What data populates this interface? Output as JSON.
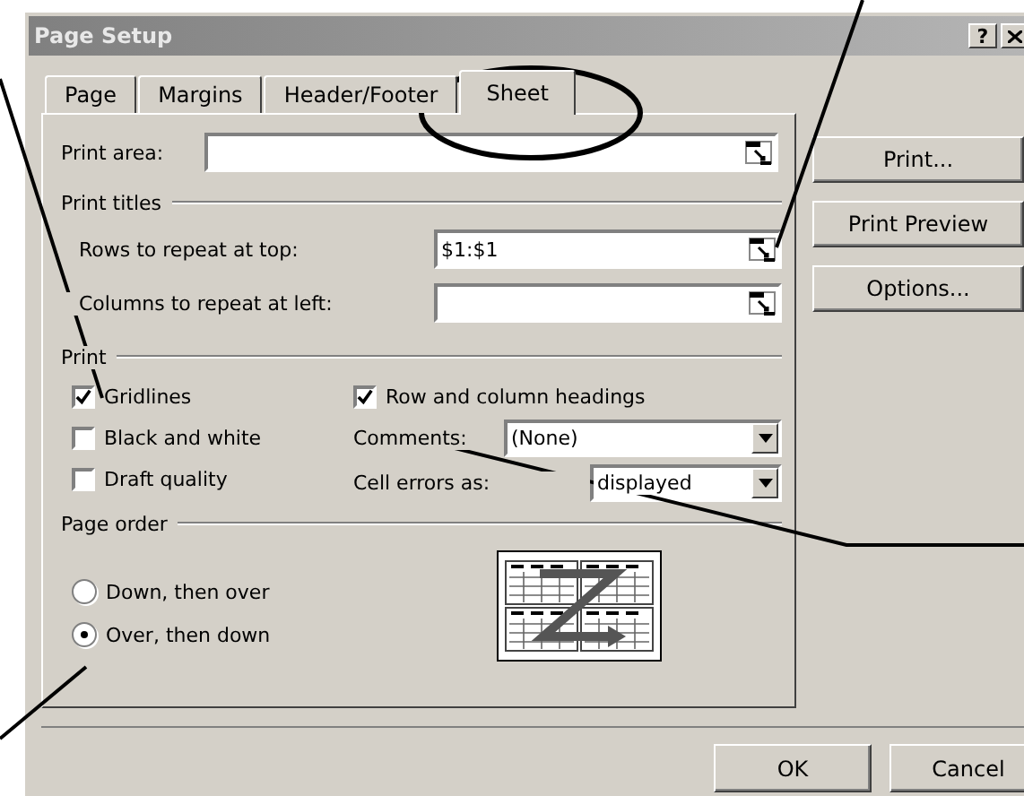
{
  "window": {
    "title": "Page Setup",
    "help_button": "?"
  },
  "tabs": [
    {
      "label": "Page",
      "selected": false
    },
    {
      "label": "Margins",
      "selected": false
    },
    {
      "label": "Header/Footer",
      "selected": false
    },
    {
      "label": "Sheet",
      "selected": true
    }
  ],
  "print_area": {
    "label": "Print area:"
  },
  "print_titles": {
    "heading": "Print titles",
    "fields": [
      {
        "label": "Rows to repeat at top:",
        "value": "$1:$1"
      },
      {
        "label": "Columns to repeat at left:"
      }
    ]
  },
  "print": {
    "heading": "Print",
    "checkboxes": [
      {
        "label": "Gridlines",
        "checked": true
      },
      {
        "label": "Black and white",
        "checked": false
      },
      {
        "label": "Draft quality",
        "checked": false
      },
      {
        "label": "Row and column headings",
        "checked": true
      }
    ],
    "comments": {
      "label": "Comments:",
      "value": "(None)"
    },
    "cell_errors": {
      "label": "Cell errors as:",
      "value": "displayed"
    }
  },
  "page_order": {
    "heading": "Page order",
    "options": [
      {
        "label": "Down, then over",
        "selected": false
      },
      {
        "label": "Over, then down",
        "selected": true
      }
    ]
  },
  "side_buttons": [
    "Print...",
    "Print Preview",
    "Options..."
  ],
  "buttons": [
    "OK",
    "Cancel"
  ]
}
